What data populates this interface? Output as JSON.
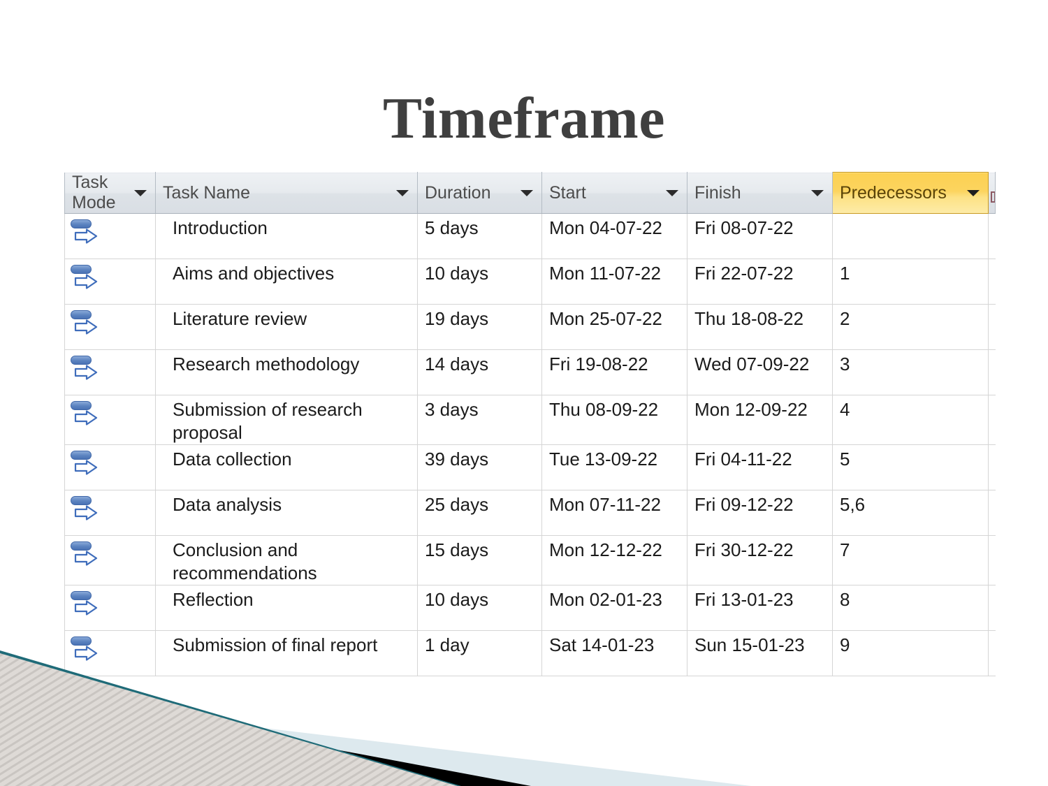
{
  "slide": {
    "title": "Timeframe",
    "title_color": "#3f3f3f",
    "background_color": "#ffffff"
  },
  "decoration": {
    "name": "powerpoint-corner-banner",
    "stripe_color": "#d8d8d4",
    "teal_line_color": "#1f6b78",
    "black_band_color": "#000000",
    "light_band_color": "#dde9ee"
  },
  "table": {
    "highlight_color": "#fcd45f",
    "header_bg_color": "#e4e8ec",
    "grid_color": "#d5d5d5",
    "columns": [
      {
        "key": "task_mode",
        "label": "Task\nMode",
        "highlighted": false
      },
      {
        "key": "task_name",
        "label": "Task Name",
        "highlighted": false
      },
      {
        "key": "duration",
        "label": "Duration",
        "highlighted": false
      },
      {
        "key": "start",
        "label": "Start",
        "highlighted": false
      },
      {
        "key": "finish",
        "label": "Finish",
        "highlighted": false
      },
      {
        "key": "predecessors",
        "label": "Predecessors",
        "highlighted": true
      }
    ],
    "task_mode_icon": "manually-scheduled-task-icon",
    "rows": [
      {
        "task_mode": "manually-scheduled-task-icon",
        "task_name": "Introduction",
        "duration": "5 days",
        "start": "Mon 04-07-22",
        "finish": "Fri 08-07-22",
        "predecessors": ""
      },
      {
        "task_mode": "manually-scheduled-task-icon",
        "task_name": "Aims and objectives",
        "duration": "10 days",
        "start": "Mon 11-07-22",
        "finish": "Fri 22-07-22",
        "predecessors": "1"
      },
      {
        "task_mode": "manually-scheduled-task-icon",
        "task_name": "Literature review",
        "duration": "19 days",
        "start": "Mon 25-07-22",
        "finish": "Thu 18-08-22",
        "predecessors": "2"
      },
      {
        "task_mode": "manually-scheduled-task-icon",
        "task_name": "Research methodology",
        "duration": "14 days",
        "start": "Fri 19-08-22",
        "finish": "Wed 07-09-22",
        "predecessors": "3"
      },
      {
        "task_mode": "manually-scheduled-task-icon",
        "task_name": "Submission of research proposal",
        "duration": "3 days",
        "start": "Thu 08-09-22",
        "finish": "Mon 12-09-22",
        "predecessors": "4"
      },
      {
        "task_mode": "manually-scheduled-task-icon",
        "task_name": "Data collection",
        "duration": "39 days",
        "start": "Tue 13-09-22",
        "finish": "Fri 04-11-22",
        "predecessors": "5"
      },
      {
        "task_mode": "manually-scheduled-task-icon",
        "task_name": "Data analysis",
        "duration": "25 days",
        "start": "Mon 07-11-22",
        "finish": "Fri 09-12-22",
        "predecessors": "5,6"
      },
      {
        "task_mode": "manually-scheduled-task-icon",
        "task_name": "Conclusion and recommendations",
        "duration": "15 days",
        "start": "Mon 12-12-22",
        "finish": "Fri 30-12-22",
        "predecessors": "7"
      },
      {
        "task_mode": "manually-scheduled-task-icon",
        "task_name": "Reflection",
        "duration": "10 days",
        "start": "Mon 02-01-23",
        "finish": "Fri 13-01-23",
        "predecessors": "8"
      },
      {
        "task_mode": "manually-scheduled-task-icon",
        "task_name": "Submission of final report",
        "duration": "1 day",
        "start": "Sat 14-01-23",
        "finish": "Sun 15-01-23",
        "predecessors": "9"
      }
    ]
  }
}
